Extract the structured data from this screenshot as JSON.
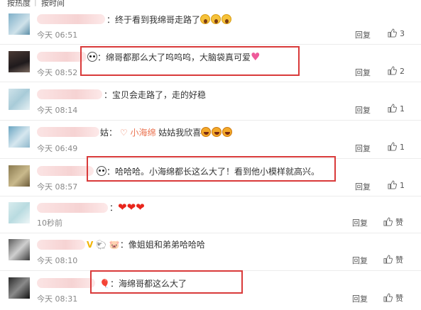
{
  "top_tabs": [
    "按热度",
    "按时间"
  ],
  "comments": [
    {
      "text": "终于看到我绵哥走路了",
      "emoji": [
        "scream",
        "scream",
        "scream"
      ],
      "time": "今天 06:51",
      "reply": "回复",
      "like_count": "3"
    },
    {
      "badge": "panda",
      "text": "绵哥都那么大了呜呜呜，大脑袋真可爱",
      "emoji_after": "heart-sparkle",
      "time": "今天 08:52",
      "reply": "回复",
      "like_count": "2"
    },
    {
      "text": "宝贝会走路了，走的好稳",
      "time": "今天 08:14",
      "reply": "回复",
      "like_count": "1"
    },
    {
      "name_suffix": "姑",
      "mention": "小海绵",
      "text": "姑姑我欣喜",
      "emoji": [
        "laugh",
        "laugh",
        "laugh"
      ],
      "time": "今天 06:49",
      "reply": "回复",
      "like_count": "1"
    },
    {
      "badge": "panda",
      "text": "哈哈哈。小海绵都长这么大了！看到他小模样就高兴。",
      "time": "今天 08:57",
      "reply": "回复",
      "like_count": "1"
    },
    {
      "hearts": 3,
      "time": "10秒前",
      "reply": "回复",
      "like_label": "赞"
    },
    {
      "text": "像姐姐和弟弟哈哈哈",
      "time": "今天 08:10",
      "reply": "回复",
      "like_label": "赞"
    },
    {
      "text": "海绵哥都这么大了",
      "time": "今天 08:31",
      "reply": "回复",
      "like_label": "赞"
    }
  ],
  "colors": {
    "highlight_box": "#d93a3a",
    "mention": "#eb7350",
    "time": "#888888"
  },
  "icons": [
    "thumbs-up-icon",
    "panda-badge-icon",
    "mention-icon"
  ]
}
